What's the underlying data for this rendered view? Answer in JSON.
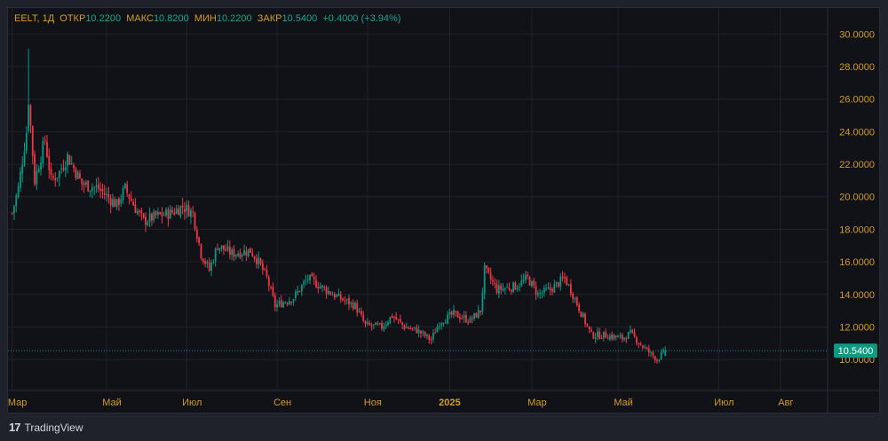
{
  "legend": {
    "symbol": "EELT, 1Д",
    "open_label": "ОТКР",
    "open": "10.2200",
    "high_label": "МАКС",
    "high": "10.8200",
    "low_label": "МИН",
    "low": "10.2200",
    "close_label": "ЗАКР",
    "close": "10.5400",
    "change": "+0.4000 (+3.94%)"
  },
  "brand": {
    "name": "TradingView",
    "icon": "tradingview-logo-icon"
  },
  "colors": {
    "up": "#089981",
    "down": "#f23645",
    "axis_text": "#d39d2c",
    "last_price_bg": "#0e9a80"
  },
  "chart_data": {
    "type": "candlestick",
    "x_unit": "bar index",
    "x_range": [
      -2,
      397
    ],
    "ylim": [
      8.1,
      31.6
    ],
    "y_ticks": [
      "30.0000",
      "28.0000",
      "26.0000",
      "24.0000",
      "22.0000",
      "20.0000",
      "18.0000",
      "16.0000",
      "14.0000",
      "12.0000",
      "10.0000"
    ],
    "x_ticks": [
      {
        "label": "Мар",
        "bar": 0
      },
      {
        "label": "Май",
        "bar": 46
      },
      {
        "label": "Июл",
        "bar": 85
      },
      {
        "label": "Сен",
        "bar": 129
      },
      {
        "label": "Ноя",
        "bar": 173
      },
      {
        "label": "2025",
        "bar": 213
      },
      {
        "label": "Мар",
        "bar": 253
      },
      {
        "label": "Май",
        "bar": 295
      },
      {
        "label": "Июл",
        "bar": 344
      },
      {
        "label": "Авг",
        "bar": 374
      }
    ],
    "close_path": [
      [
        0,
        19.0
      ],
      [
        3,
        20.5
      ],
      [
        7,
        24.0
      ],
      [
        8,
        26.0
      ],
      [
        11,
        21.0
      ],
      [
        16,
        23.5
      ],
      [
        19,
        21.0
      ],
      [
        23,
        21.5
      ],
      [
        27,
        22.5
      ],
      [
        34,
        20.8
      ],
      [
        42,
        20.5
      ],
      [
        51,
        19.5
      ],
      [
        55,
        20.5
      ],
      [
        60,
        19.3
      ],
      [
        64,
        18.5
      ],
      [
        70,
        18.8
      ],
      [
        77,
        19.0
      ],
      [
        83,
        19.4
      ],
      [
        88,
        19.0
      ],
      [
        92,
        16.5
      ],
      [
        96,
        15.5
      ],
      [
        100,
        17.0
      ],
      [
        107,
        16.5
      ],
      [
        116,
        16.7
      ],
      [
        120,
        16.0
      ],
      [
        124,
        15.0
      ],
      [
        128,
        13.3
      ],
      [
        137,
        13.8
      ],
      [
        144,
        15.0
      ],
      [
        150,
        14.5
      ],
      [
        159,
        13.8
      ],
      [
        167,
        13.3
      ],
      [
        172,
        12.1
      ],
      [
        180,
        12.0
      ],
      [
        185,
        12.7
      ],
      [
        191,
        12.0
      ],
      [
        197,
        11.8
      ],
      [
        204,
        11.2
      ],
      [
        208,
        12.3
      ],
      [
        215,
        12.8
      ],
      [
        223,
        12.4
      ],
      [
        228,
        13.0
      ],
      [
        230,
        15.5
      ],
      [
        236,
        14.3
      ],
      [
        245,
        14.5
      ],
      [
        251,
        15.0
      ],
      [
        256,
        14.0
      ],
      [
        262,
        14.3
      ],
      [
        269,
        15.0
      ],
      [
        273,
        14.0
      ],
      [
        279,
        12.3
      ],
      [
        282,
        11.5
      ],
      [
        288,
        11.5
      ],
      [
        297,
        11.3
      ],
      [
        301,
        11.6
      ],
      [
        307,
        10.8
      ],
      [
        314,
        10.0
      ],
      [
        318,
        10.54
      ]
    ],
    "peak_high": 29.1,
    "last_candle": {
      "open": 10.22,
      "high": 10.82,
      "low": 10.22,
      "close": 10.54
    },
    "last_price_label": "10.5400"
  }
}
